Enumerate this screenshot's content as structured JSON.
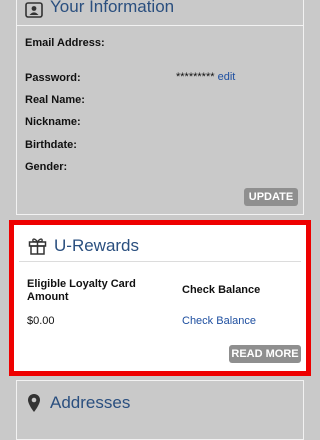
{
  "your_information": {
    "title": "Your Information",
    "icon": "contact-card-icon",
    "fields": {
      "email_label": "Email Address:",
      "password_label": "Password:",
      "password_value": "*********",
      "password_edit": "edit",
      "real_name_label": "Real Name:",
      "nickname_label": "Nickname:",
      "birthdate_label": "Birthdate:",
      "gender_label": "Gender:"
    },
    "update_button": "UPDATE"
  },
  "u_rewards": {
    "title": "U-Rewards",
    "icon": "gift-icon",
    "col1_header": "Eligible Loyalty Card Amount",
    "col2_header": "Check Balance",
    "amount": "$0.00",
    "check_balance_link": "Check Balance",
    "read_more_button": "READ MORE",
    "highlight_color": "#ee0000"
  },
  "addresses": {
    "title": "Addresses",
    "icon": "map-pin-icon"
  },
  "colors": {
    "title_blue": "#2a4f7f",
    "link_blue": "#1e4fa0",
    "button_gray": "#8f8f8f",
    "background_gray": "#c9c9c9"
  }
}
